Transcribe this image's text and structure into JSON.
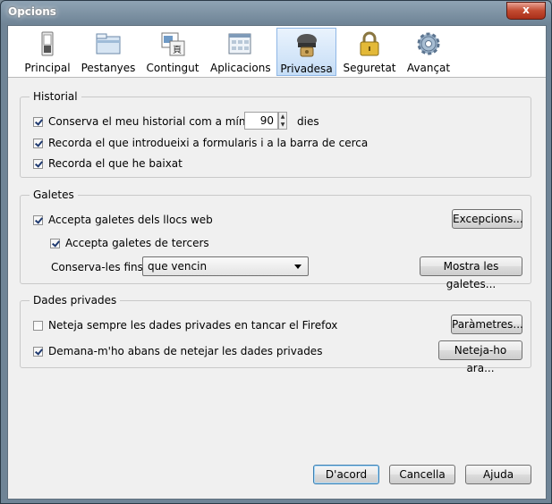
{
  "window": {
    "title": "Opcions",
    "close_label": "x"
  },
  "toolbar": {
    "panes": [
      {
        "label": "Principal",
        "icon": "switch-icon"
      },
      {
        "label": "Pestanyes",
        "icon": "folder-tabs-icon"
      },
      {
        "label": "Contingut",
        "icon": "content-page-icon"
      },
      {
        "label": "Aplicacions",
        "icon": "applications-window-icon"
      },
      {
        "label": "Privadesa",
        "icon": "privacy-mask-icon",
        "selected": true
      },
      {
        "label": "Seguretat",
        "icon": "padlock-icon"
      },
      {
        "label": "Avançat",
        "icon": "gear-icon"
      }
    ]
  },
  "historial": {
    "legend": "Historial",
    "keep_history_label": "Conserva el meu historial com a mínim",
    "keep_history_days": "90",
    "days_unit": "dies",
    "remember_forms_label": "Recorda el que introdueixi a formularis i a la barra de cerca",
    "remember_downloads_label": "Recorda el que he baixat",
    "keep_history_checked": true,
    "remember_forms_checked": true,
    "remember_downloads_checked": true
  },
  "galetes": {
    "legend": "Galetes",
    "accept_cookies_label": "Accepta galetes dels llocs web",
    "accept_third_party_label": "Accepta galetes de tercers",
    "keep_until_label": "Conserva-les fins:",
    "keep_until_value": "que vencin",
    "exceptions_button": "Excepcions...",
    "show_cookies_button": "Mostra les galetes...",
    "accept_cookies_checked": true,
    "accept_third_party_checked": true
  },
  "dades_privades": {
    "legend": "Dades privades",
    "always_clear_label": "Neteja sempre les dades privades en tancar el Firefox",
    "ask_before_label": "Demana-m'ho abans de netejar les dades privades",
    "settings_button": "Paràmetres...",
    "clear_now_button": "Neteja-ho ara...",
    "always_clear_checked": false,
    "ask_before_checked": true
  },
  "footer": {
    "ok_button": "D'acord",
    "cancel_button": "Cancella",
    "help_button": "Ajuda"
  },
  "colors": {
    "selected_pane": "#c5ddf6",
    "accent": "#3c7fb1",
    "close": "#c24a30"
  }
}
